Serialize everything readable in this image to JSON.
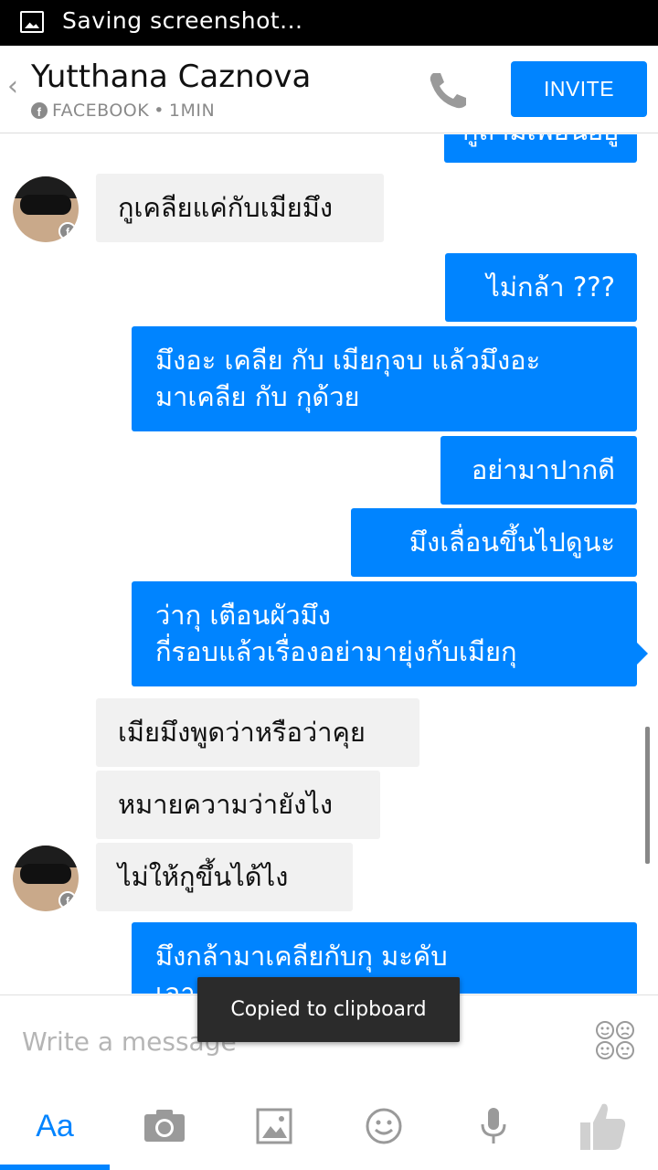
{
  "status_bar": {
    "notification": "Saving screenshot..."
  },
  "header": {
    "name": "Yutthana Caznova",
    "source": "FACEBOOK",
    "time": "1MIN",
    "invite_label": "INVITE"
  },
  "messages": [
    {
      "from": "me",
      "text": "กูถามเพื่อนอยู่"
    },
    {
      "from": "them",
      "text": "กูเคลียแค่กับเมียมึง"
    },
    {
      "from": "me",
      "text": "ไม่กล้า ???"
    },
    {
      "from": "me",
      "lines": [
        "มึงอะ เคลีย กับ เมียกุจบ แล้วมึงอะ",
        "มาเคลีย กับ กุด้วย"
      ]
    },
    {
      "from": "me",
      "text": "อย่ามาปากดี"
    },
    {
      "from": "me",
      "text": "มึงเลื่อนขึ้นไปดูนะ"
    },
    {
      "from": "me",
      "lines": [
        "ว่ากุ เตือนผัวมึง",
        "กี่รอบแล้วเรื่องอย่ามายุ่งกับเมียกุ"
      ]
    },
    {
      "from": "them",
      "text": "เมียมึงพูดว่าหรือว่าคุย"
    },
    {
      "from": "them",
      "text": "หมายความว่ายังไง"
    },
    {
      "from": "them",
      "text": "ไม่ให้กูขึ้นได้ไง"
    },
    {
      "from": "me",
      "lines": [
        "มึงกล้ามาเคลียกับกุ มะคับ",
        "เอา"
      ]
    }
  ],
  "composer": {
    "placeholder": "Write a message"
  },
  "toast": "Copied to clipboard",
  "toolbar": {
    "text_mode_label": "Aa"
  },
  "colors": {
    "accent": "#0084ff",
    "incoming_bubble": "#f1f1f1"
  },
  "icons": [
    "image-icon",
    "facebook-icon",
    "phone-icon",
    "sticker-icon",
    "camera-icon",
    "gallery-icon",
    "emoji-icon",
    "microphone-icon",
    "thumbs-up-icon"
  ]
}
